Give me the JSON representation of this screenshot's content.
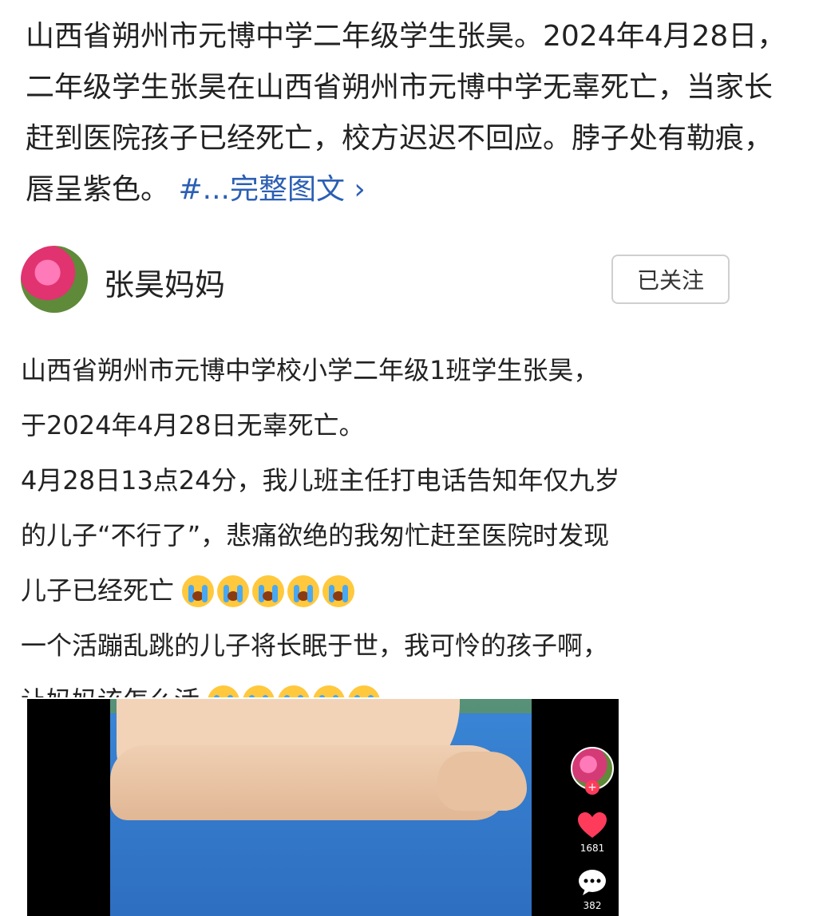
{
  "headline": {
    "text": "山西省朔州市元博中学二年级学生张昊。2024年4月28日，二年级学生张昊在山西省朔州市元博中学无辜死亡，当家长赶到医院孩子已经死亡，校方迟迟不回应。脖子处有勒痕，唇呈紫色。",
    "more_link": "#...完整图文",
    "chevron": "›"
  },
  "author": {
    "name": "张昊妈妈",
    "follow_label": "已关注"
  },
  "post": {
    "lines": [
      "山西省朔州市元博中学校小学二年级1班学生张昊，",
      "于2024年4月28日无辜死亡。",
      "4月28日13点24分，我儿班主任打电话告知年仅九岁",
      "的儿子“不行了”，悲痛欲绝的我匆忙赶至医院时发现",
      "儿子已经死亡",
      "一个活蹦乱跳的儿子将长眠于世，我可怜的孩子啊，",
      "让妈妈该怎么活"
    ]
  },
  "video": {
    "likes": "1681",
    "comments": "382"
  },
  "colors": {
    "link": "#2b5fb4",
    "like": "#ff3b5c"
  }
}
